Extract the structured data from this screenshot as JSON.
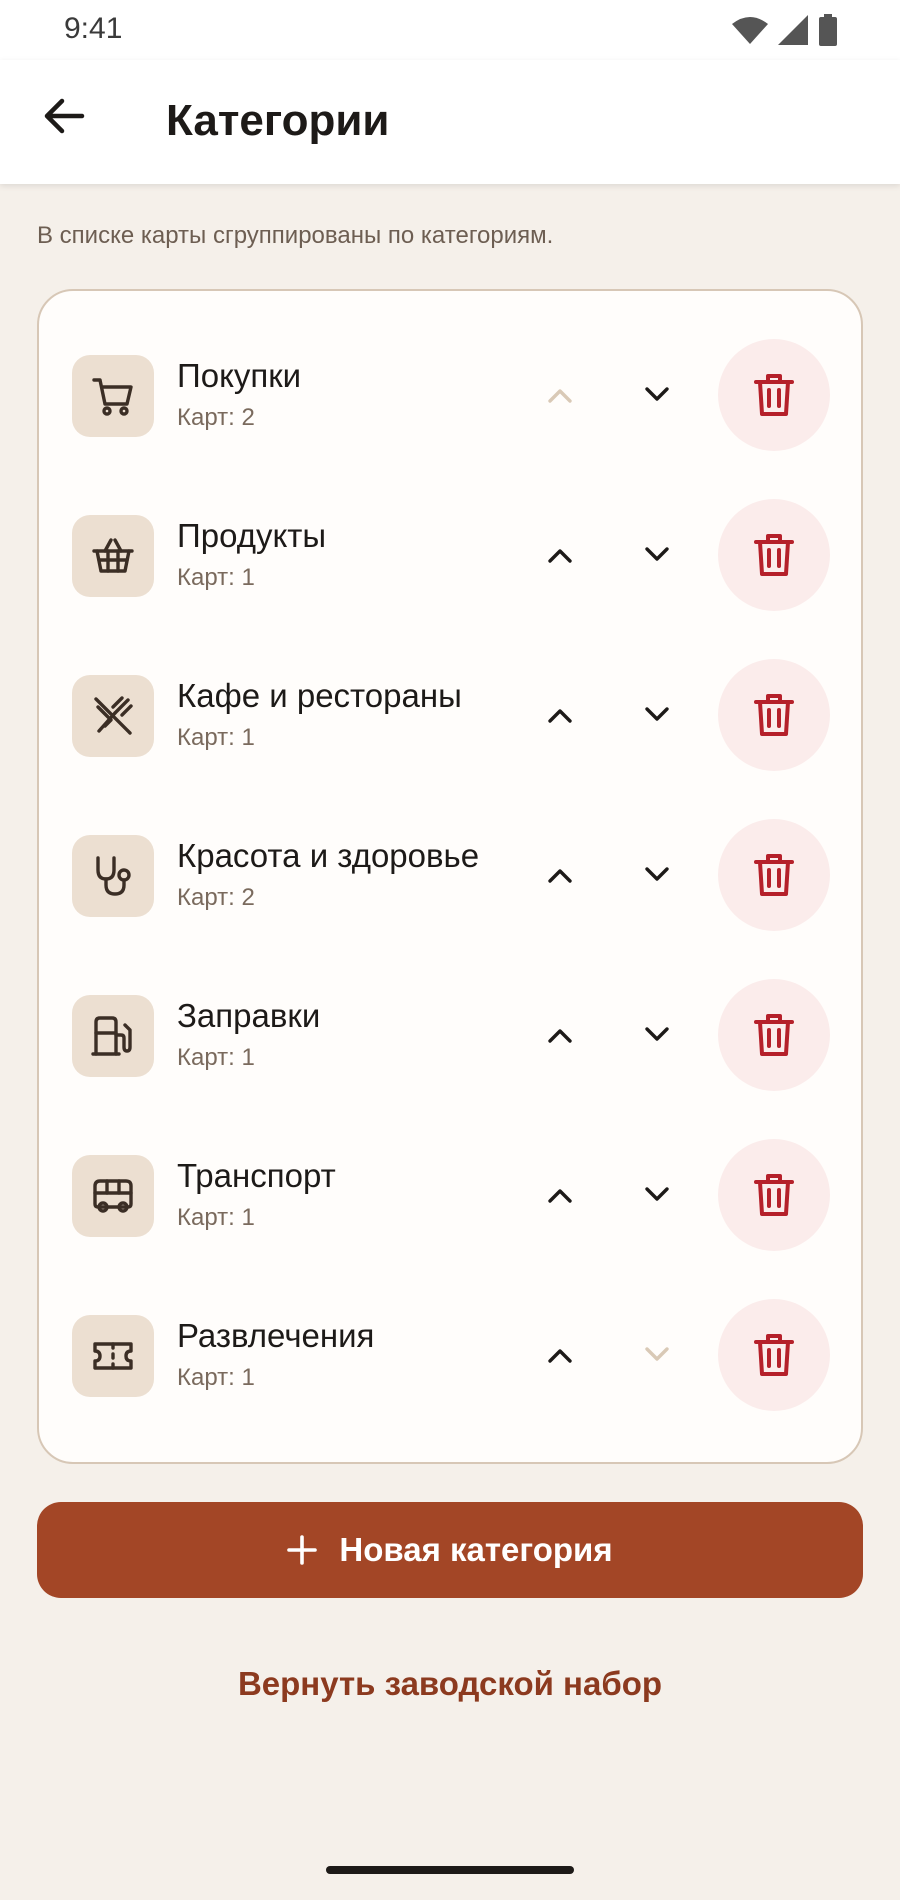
{
  "status_bar": {
    "time": "9:41"
  },
  "app_bar": {
    "title": "Категории"
  },
  "hint": "В списке карты сгруппированы по категориям.",
  "categories": [
    {
      "name": "Покупки",
      "count": "Карт: 2",
      "icon": "cart-icon",
      "up_enabled": false,
      "down_enabled": true
    },
    {
      "name": "Продукты",
      "count": "Карт: 1",
      "icon": "basket-icon",
      "up_enabled": true,
      "down_enabled": true
    },
    {
      "name": "Кафе и рестораны",
      "count": "Карт: 1",
      "icon": "cutlery-icon",
      "up_enabled": true,
      "down_enabled": true
    },
    {
      "name": "Красота и здоровье",
      "count": "Карт: 2",
      "icon": "stethoscope-icon",
      "up_enabled": true,
      "down_enabled": true
    },
    {
      "name": "Заправки",
      "count": "Карт: 1",
      "icon": "fuel-icon",
      "up_enabled": true,
      "down_enabled": true
    },
    {
      "name": "Транспорт",
      "count": "Карт: 1",
      "icon": "bus-icon",
      "up_enabled": true,
      "down_enabled": true
    },
    {
      "name": "Развлечения",
      "count": "Карт: 1",
      "icon": "ticket-icon",
      "up_enabled": true,
      "down_enabled": false
    }
  ],
  "actions": {
    "add_label": "Новая категория",
    "reset_label": "Вернуть заводской набор"
  },
  "colors": {
    "accent": "#a34626",
    "delete": "#b5202a",
    "delete_bg": "#fbeceb",
    "icon_bg": "#ecdfd1",
    "background": "#f5f0ea"
  }
}
